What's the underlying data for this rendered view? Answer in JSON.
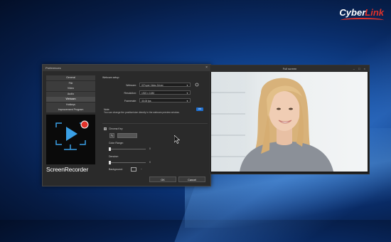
{
  "brand": {
    "name_white": "Cyber",
    "name_red": "Link"
  },
  "preferences": {
    "title": "Preferences",
    "close_label": "×",
    "sidebar_items": [
      {
        "label": "General",
        "active": false
      },
      {
        "label": "File",
        "active": false
      },
      {
        "label": "Video",
        "active": false
      },
      {
        "label": "Audio",
        "active": false
      },
      {
        "label": "Webcam",
        "active": true
      },
      {
        "label": "Hotkeys",
        "active": false
      },
      {
        "label": "Improvement Program",
        "active": false
      }
    ],
    "product_name": "ScreenRecorder",
    "webcam_setup": {
      "section_label": "Webcam setup:",
      "webcam_label": "Webcam:",
      "webcam_value": "ICFoyer Video Driver",
      "resolution_label": "Resolution:",
      "resolution_value": "1920 x 1080",
      "framerate_label": "Framerate:",
      "framerate_value": "30.00 fps"
    },
    "note_title": "Note:",
    "note_text": "You can change the position/size directly in the webcam preview window.",
    "note_toggle": "ON",
    "chroma_key_label": "Chroma Key",
    "color_range_label": "Color Range:",
    "color_range_value": "0",
    "denoise_label": "Denoise:",
    "denoise_value": "0",
    "background_label": "Background:",
    "ok_label": "OK",
    "cancel_label": "Cancel"
  },
  "fullscreen": {
    "title": "Full screen",
    "controls": "– □ ×"
  },
  "colors": {
    "accent": "#1e6fd0",
    "brand_red": "#e0322a"
  }
}
